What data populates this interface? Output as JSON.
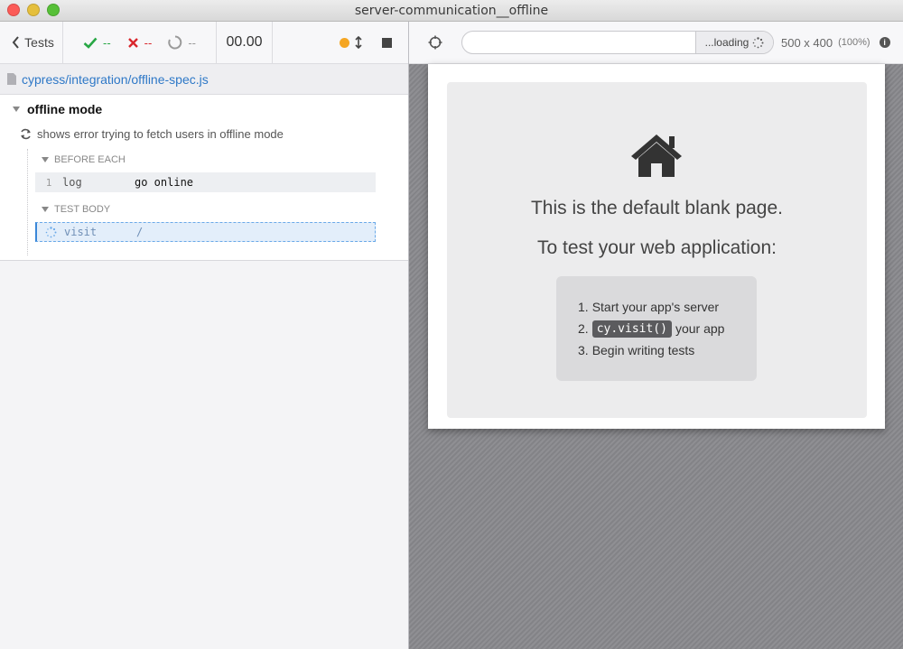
{
  "window": {
    "title": "server-communication__offline"
  },
  "reporter": {
    "tests_label": "Tests",
    "passed": "--",
    "failed": "--",
    "pending": "--",
    "duration": "00.00",
    "spec_path": "cypress/integration/offline-spec.js",
    "suite_title": "offline mode",
    "test_title": "shows error trying to fetch users in offline mode",
    "before_each_label": "BEFORE EACH",
    "test_body_label": "TEST BODY",
    "commands_before": [
      {
        "num": "1",
        "name": "log",
        "message": "go online"
      }
    ],
    "commands_body": [
      {
        "name": "visit",
        "message": "/"
      }
    ]
  },
  "aut": {
    "url_value": "",
    "loading_label": "...loading",
    "viewport_size": "500 x 400",
    "viewport_pct": "(100%)",
    "blank_title": "This is the default blank page.",
    "blank_subtitle": "To test your web application:",
    "step1": "Start your app's server",
    "step2_code": "cy.visit()",
    "step2_rest": "your app",
    "step3": "Begin writing tests",
    "step1_num": "1.",
    "step2_num": "2.",
    "step3_num": "3."
  },
  "colors": {
    "pass": "#28a745",
    "fail": "#d9262c",
    "running": "#f5a623",
    "link": "#2e78c7"
  }
}
